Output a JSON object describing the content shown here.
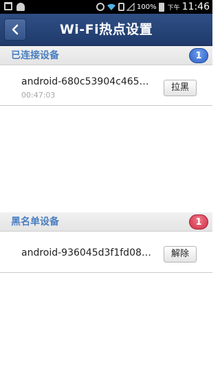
{
  "status_bar": {
    "battery_percent": "100%",
    "ampm": "下午",
    "time": "11:46"
  },
  "header": {
    "title": "Wi-Fi热点设置"
  },
  "connected": {
    "title": "已连接设备",
    "count": "1",
    "devices": [
      {
        "name": "android-680c53904c465…",
        "time": "00:47:03",
        "action": "拉黑"
      }
    ]
  },
  "blacklist": {
    "title": "黑名单设备",
    "count": "1",
    "devices": [
      {
        "name": "android-936045d3f1fd08…",
        "action": "解除"
      }
    ]
  },
  "colors": {
    "title_bar": "#2f4f84",
    "section_title": "#4a7fc1",
    "badge_connected": "#2c5fc4",
    "badge_blacklist": "#cf2b45"
  }
}
